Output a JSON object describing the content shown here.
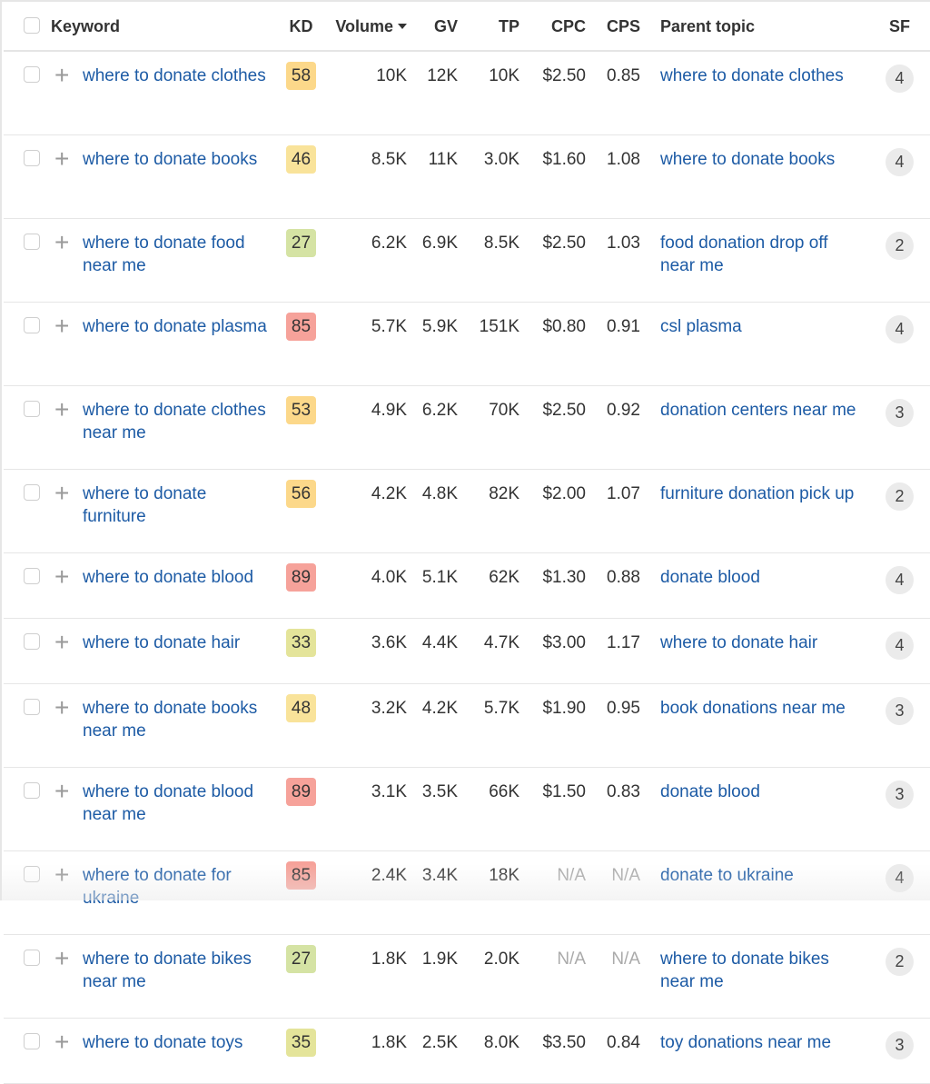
{
  "columns": {
    "keyword": "Keyword",
    "kd": "KD",
    "volume": "Volume",
    "gv": "GV",
    "tp": "TP",
    "cpc": "CPC",
    "cps": "CPS",
    "parent_topic": "Parent topic",
    "sf": "SF"
  },
  "sort": {
    "column": "volume",
    "direction": "desc",
    "icon": "caret-down-icon"
  },
  "kd_colors": {
    "green": "#d5e3a4",
    "lime": "#e4e49a",
    "light_yellow": "#f9e39a",
    "yellow": "#fcd88a",
    "red": "#f6a29a"
  },
  "link_color": "#1d5ba5",
  "rows": [
    {
      "keyword": "where to donate clothes",
      "kd": "58",
      "kd_color": "#fcd88a",
      "volume": "10K",
      "gv": "12K",
      "tp": "10K",
      "cpc": "$2.50",
      "cps": "0.85",
      "parent_topic": "where to donate clothes",
      "sf": "4",
      "tall": true
    },
    {
      "keyword": "where to donate books",
      "kd": "46",
      "kd_color": "#f9e39a",
      "volume": "8.5K",
      "gv": "11K",
      "tp": "3.0K",
      "cpc": "$1.60",
      "cps": "1.08",
      "parent_topic": "where to donate books",
      "sf": "4",
      "tall": true
    },
    {
      "keyword": "where to donate food near me",
      "kd": "27",
      "kd_color": "#d5e3a4",
      "volume": "6.2K",
      "gv": "6.9K",
      "tp": "8.5K",
      "cpc": "$2.50",
      "cps": "1.03",
      "parent_topic": "food donation drop off near me",
      "sf": "2",
      "tall": true
    },
    {
      "keyword": "where to donate plasma",
      "kd": "85",
      "kd_color": "#f6a29a",
      "volume": "5.7K",
      "gv": "5.9K",
      "tp": "151K",
      "cpc": "$0.80",
      "cps": "0.91",
      "parent_topic": "csl plasma",
      "sf": "4",
      "tall": true
    },
    {
      "keyword": "where to donate clothes near me",
      "kd": "53",
      "kd_color": "#fcd88a",
      "volume": "4.9K",
      "gv": "6.2K",
      "tp": "70K",
      "cpc": "$2.50",
      "cps": "0.92",
      "parent_topic": "donation centers near me",
      "sf": "3",
      "tall": true
    },
    {
      "keyword": "where to donate furniture",
      "kd": "56",
      "kd_color": "#fcd88a",
      "volume": "4.2K",
      "gv": "4.8K",
      "tp": "82K",
      "cpc": "$2.00",
      "cps": "1.07",
      "parent_topic": "furniture donation pick up",
      "sf": "2",
      "tall": true
    },
    {
      "keyword": "where to donate blood",
      "kd": "89",
      "kd_color": "#f6a29a",
      "volume": "4.0K",
      "gv": "5.1K",
      "tp": "62K",
      "cpc": "$1.30",
      "cps": "0.88",
      "parent_topic": "donate blood",
      "sf": "4",
      "tall": false
    },
    {
      "keyword": "where to donate hair",
      "kd": "33",
      "kd_color": "#e4e49a",
      "volume": "3.6K",
      "gv": "4.4K",
      "tp": "4.7K",
      "cpc": "$3.00",
      "cps": "1.17",
      "parent_topic": "where to donate hair",
      "sf": "4",
      "tall": false
    },
    {
      "keyword": "where to donate books near me",
      "kd": "48",
      "kd_color": "#f9e39a",
      "volume": "3.2K",
      "gv": "4.2K",
      "tp": "5.7K",
      "cpc": "$1.90",
      "cps": "0.95",
      "parent_topic": "book donations near me",
      "sf": "3",
      "tall": true
    },
    {
      "keyword": "where to donate blood near me",
      "kd": "89",
      "kd_color": "#f6a29a",
      "volume": "3.1K",
      "gv": "3.5K",
      "tp": "66K",
      "cpc": "$1.50",
      "cps": "0.83",
      "parent_topic": "donate blood",
      "sf": "3",
      "tall": true
    },
    {
      "keyword": "where to donate for ukraine",
      "kd": "85",
      "kd_color": "#f6a29a",
      "volume": "2.4K",
      "gv": "3.4K",
      "tp": "18K",
      "cpc": "N/A",
      "cps": "N/A",
      "parent_topic": "donate to ukraine",
      "sf": "4",
      "tall": true
    },
    {
      "keyword": "where to donate bikes near me",
      "kd": "27",
      "kd_color": "#d5e3a4",
      "volume": "1.8K",
      "gv": "1.9K",
      "tp": "2.0K",
      "cpc": "N/A",
      "cps": "N/A",
      "parent_topic": "where to donate bikes near me",
      "sf": "2",
      "tall": true
    },
    {
      "keyword": "where to donate toys",
      "kd": "35",
      "kd_color": "#e4e49a",
      "volume": "1.8K",
      "gv": "2.5K",
      "tp": "8.0K",
      "cpc": "$3.50",
      "cps": "0.84",
      "parent_topic": "toy donations near me",
      "sf": "3",
      "tall": false
    }
  ]
}
